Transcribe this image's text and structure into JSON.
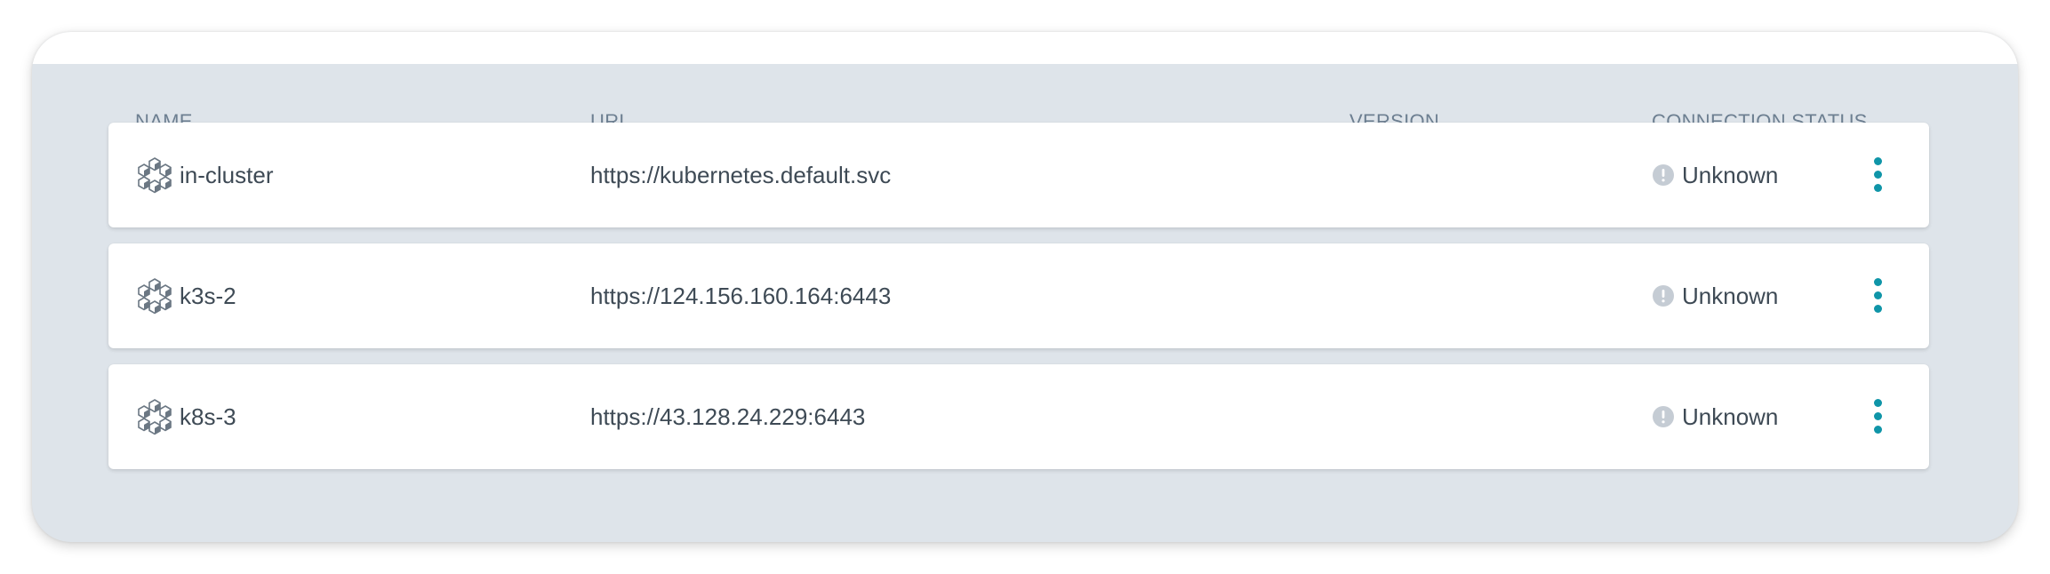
{
  "table": {
    "headers": {
      "name": "NAME",
      "url": "URL",
      "version": "VERSION",
      "connection_status": "CONNECTION STATUS"
    },
    "rows": [
      {
        "name": "in-cluster",
        "url": "https://kubernetes.default.svc",
        "version": "",
        "status": "Unknown",
        "icon": "cluster-icon",
        "status_icon": "info-icon",
        "menu_icon": "more-vertical-icon"
      },
      {
        "name": "k3s-2",
        "url": "https://124.156.160.164:6443",
        "version": "",
        "status": "Unknown",
        "icon": "cluster-icon",
        "status_icon": "info-icon",
        "menu_icon": "more-vertical-icon"
      },
      {
        "name": "k8s-3",
        "url": "https://43.128.24.229:6443",
        "version": "",
        "status": "Unknown",
        "icon": "cluster-icon",
        "status_icon": "info-icon",
        "menu_icon": "more-vertical-icon"
      }
    ]
  },
  "colors": {
    "panel_background": "#dee4ea",
    "header_text": "#6d7f91",
    "row_text": "#3e4a55",
    "accent": "#0f95a8",
    "status_unknown": "#c5ccd4"
  }
}
